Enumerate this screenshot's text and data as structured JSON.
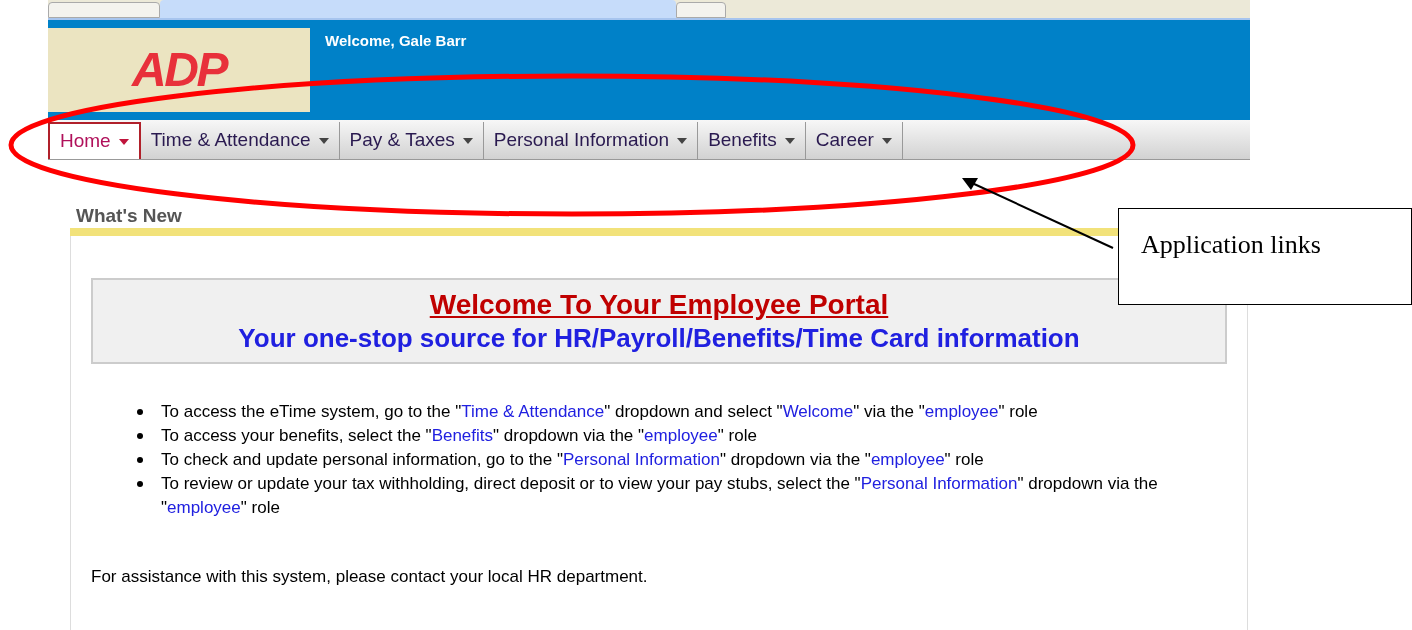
{
  "header": {
    "logo_text": "ADP",
    "welcome": "Welcome, Gale Barr"
  },
  "nav": [
    {
      "label": "Home",
      "selected": true
    },
    {
      "label": "Time & Attendance",
      "selected": false
    },
    {
      "label": "Pay & Taxes",
      "selected": false
    },
    {
      "label": "Personal Information",
      "selected": false
    },
    {
      "label": "Benefits",
      "selected": false
    },
    {
      "label": "Career",
      "selected": false
    }
  ],
  "section_title": "What's New",
  "banner": {
    "title": "Welcome To Your Employee Portal",
    "subtitle": "Your one-stop source for HR/Payroll/Benefits/Time Card information"
  },
  "bullets": [
    [
      {
        "kind": "plain",
        "text": "To access the eTime system, go to the \""
      },
      {
        "kind": "blue",
        "text": "Time & Attendance"
      },
      {
        "kind": "plain",
        "text": "\" dropdown and select \""
      },
      {
        "kind": "blue",
        "text": "Welcome"
      },
      {
        "kind": "plain",
        "text": "\" via the \""
      },
      {
        "kind": "blue",
        "text": "employee"
      },
      {
        "kind": "plain",
        "text": "\" role"
      }
    ],
    [
      {
        "kind": "plain",
        "text": "To access your benefits, select the \""
      },
      {
        "kind": "blue",
        "text": "Benefits"
      },
      {
        "kind": "plain",
        "text": "\" dropdown via the \""
      },
      {
        "kind": "blue",
        "text": "employee"
      },
      {
        "kind": "plain",
        "text": "\" role"
      }
    ],
    [
      {
        "kind": "plain",
        "text": "To check and update personal information, go to the \""
      },
      {
        "kind": "blue",
        "text": "Personal Information"
      },
      {
        "kind": "plain",
        "text": "\" dropdown via the \""
      },
      {
        "kind": "blue",
        "text": "employee"
      },
      {
        "kind": "plain",
        "text": "\" role"
      }
    ],
    [
      {
        "kind": "plain",
        "text": "To review or update your tax withholding, direct deposit or to view your pay stubs, select the \""
      },
      {
        "kind": "blue",
        "text": "Personal Information"
      },
      {
        "kind": "plain",
        "text": "\" dropdown via the \""
      },
      {
        "kind": "blue",
        "text": "employee"
      },
      {
        "kind": "plain",
        "text": "\" role"
      }
    ]
  ],
  "assistance": "For assistance with this system, please contact your local HR department.",
  "callout": "Application links"
}
